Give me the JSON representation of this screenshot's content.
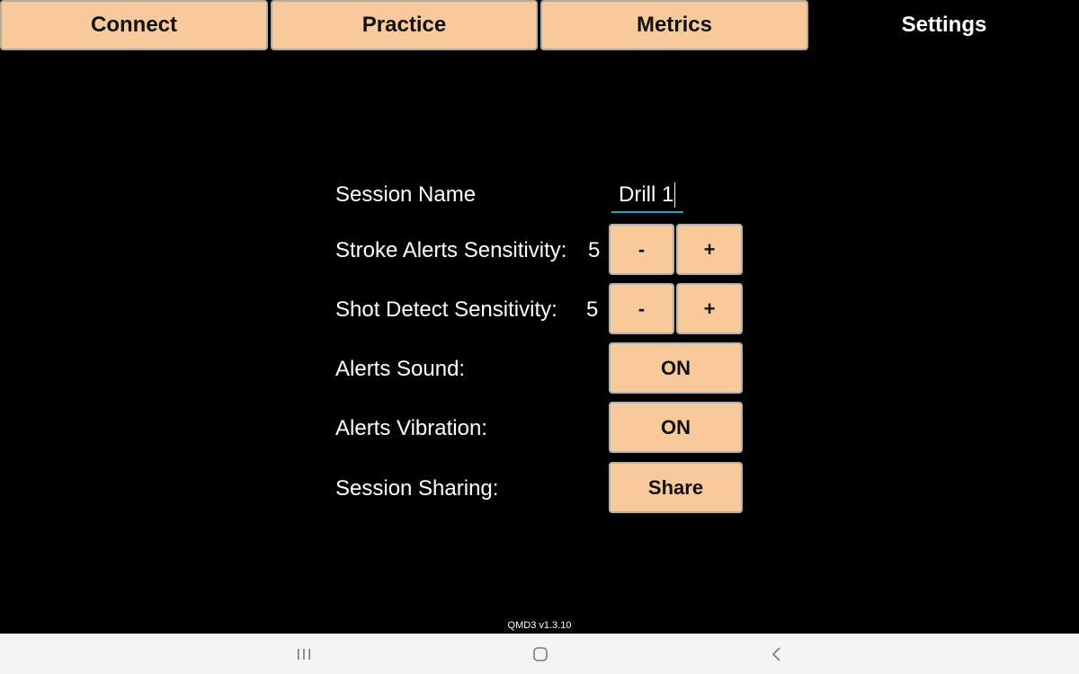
{
  "tabs": [
    {
      "label": "Connect"
    },
    {
      "label": "Practice"
    },
    {
      "label": "Metrics"
    },
    {
      "label": "Settings",
      "active": true
    }
  ],
  "settings": {
    "session_name_label": "Session Name",
    "session_name_value": "Drill 1",
    "stroke_label": "Stroke Alerts Sensitivity:",
    "stroke_value": "5",
    "shot_label": "Shot Detect Sensitivity:",
    "shot_value": "5",
    "minus_label": "-",
    "plus_label": "+",
    "sound_label": "Alerts Sound:",
    "sound_value": "ON",
    "vibration_label": "Alerts Vibration:",
    "vibration_value": "ON",
    "sharing_label": "Session Sharing:",
    "share_button": "Share"
  },
  "version": "QMD3 v1.3.10",
  "navbar": {
    "icons": [
      "recent-apps-icon",
      "home-icon",
      "back-icon"
    ]
  },
  "colors": {
    "button_bg": "#f7c99b",
    "background": "#000000",
    "input_underline": "#2aa0c7"
  }
}
